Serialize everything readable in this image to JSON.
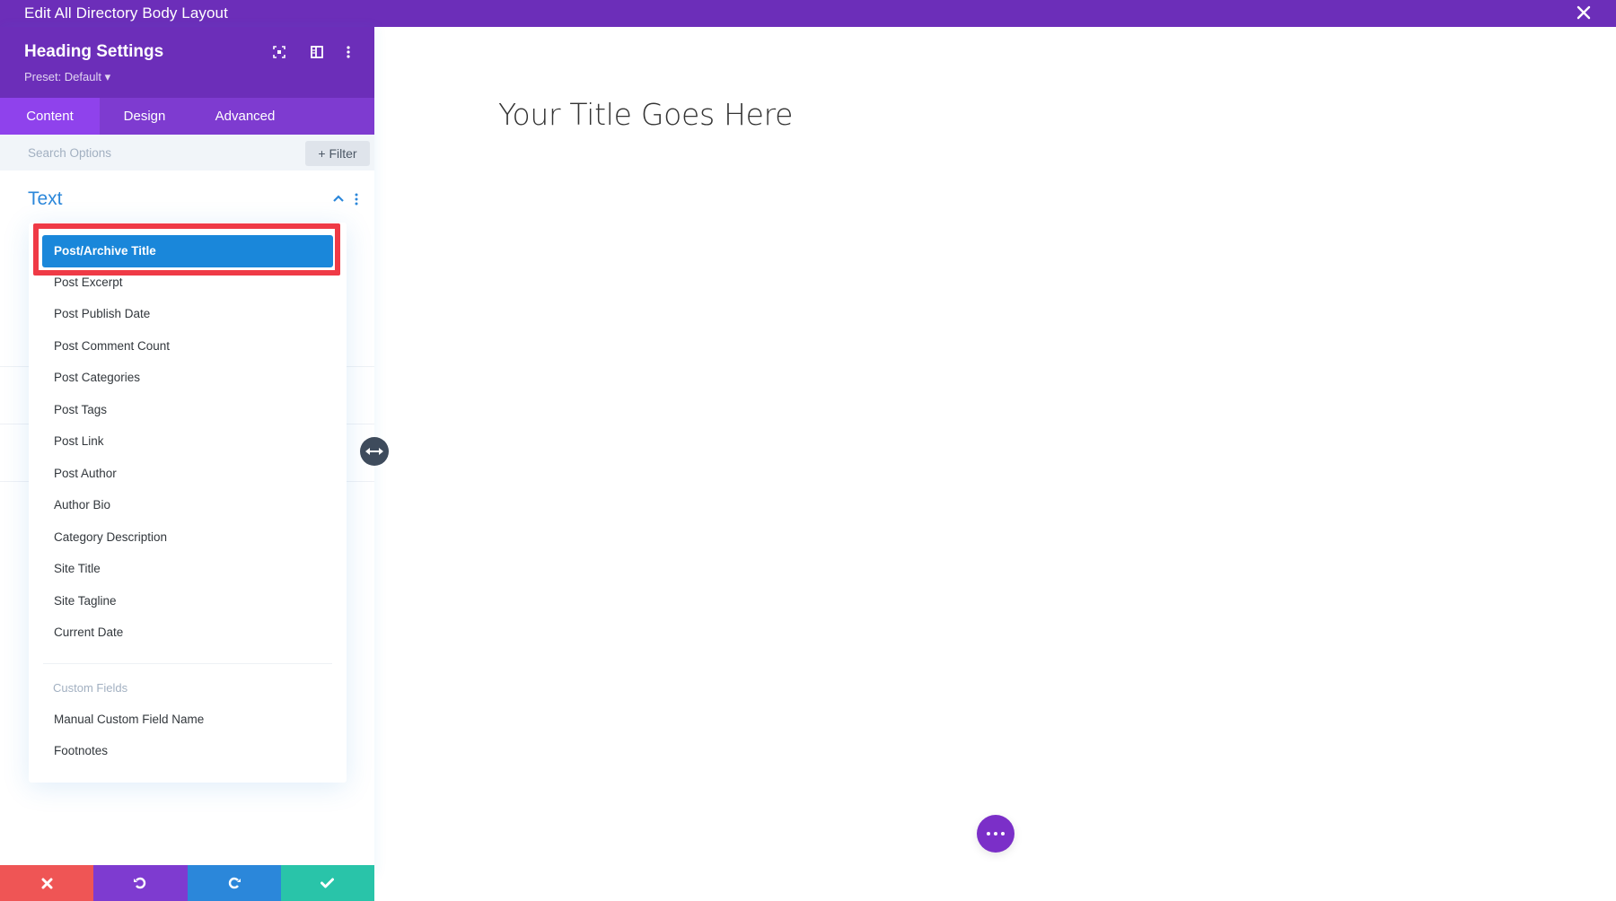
{
  "window": {
    "title": "Edit All Directory Body Layout",
    "close_icon": "close-icon"
  },
  "panel": {
    "heading": "Heading Settings",
    "preset": "Preset: Default ▾",
    "header_icons": [
      "focus-icon",
      "sidebar-layout-icon",
      "more-vertical-icon"
    ],
    "tabs": [
      {
        "label": "Content",
        "active": true
      },
      {
        "label": "Design",
        "active": false
      },
      {
        "label": "Advanced",
        "active": false
      }
    ],
    "search": {
      "placeholder": "Search Options",
      "value": ""
    },
    "filter_label": "+ Filter",
    "section": {
      "title": "Text",
      "expanded": true
    }
  },
  "dropdown": {
    "selected": "Post/Archive Title",
    "items": [
      "Post/Archive Title",
      "Post Excerpt",
      "Post Publish Date",
      "Post Comment Count",
      "Post Categories",
      "Post Tags",
      "Post Link",
      "Post Author",
      "Author Bio",
      "Category Description",
      "Site Title",
      "Site Tagline",
      "Current Date"
    ],
    "group_label": "Custom Fields",
    "group_items": [
      "Manual Custom Field Name",
      "Footnotes"
    ]
  },
  "bottom_bar": [
    {
      "action": "discard",
      "icon": "close-icon",
      "color": "#ef5555"
    },
    {
      "action": "undo",
      "icon": "undo-icon",
      "color": "#7e3bd0"
    },
    {
      "action": "redo",
      "icon": "redo-icon",
      "color": "#2b87da"
    },
    {
      "action": "save",
      "icon": "check-icon",
      "color": "#29c4a9"
    }
  ],
  "canvas": {
    "title": "Your Title Goes Here"
  },
  "colors": {
    "primary_purple": "#6c2eb9",
    "tab_purple": "#7e3bd0",
    "accent_blue": "#2b87da",
    "selected_blue": "#1a87da",
    "highlight_red": "#ef3a46"
  }
}
